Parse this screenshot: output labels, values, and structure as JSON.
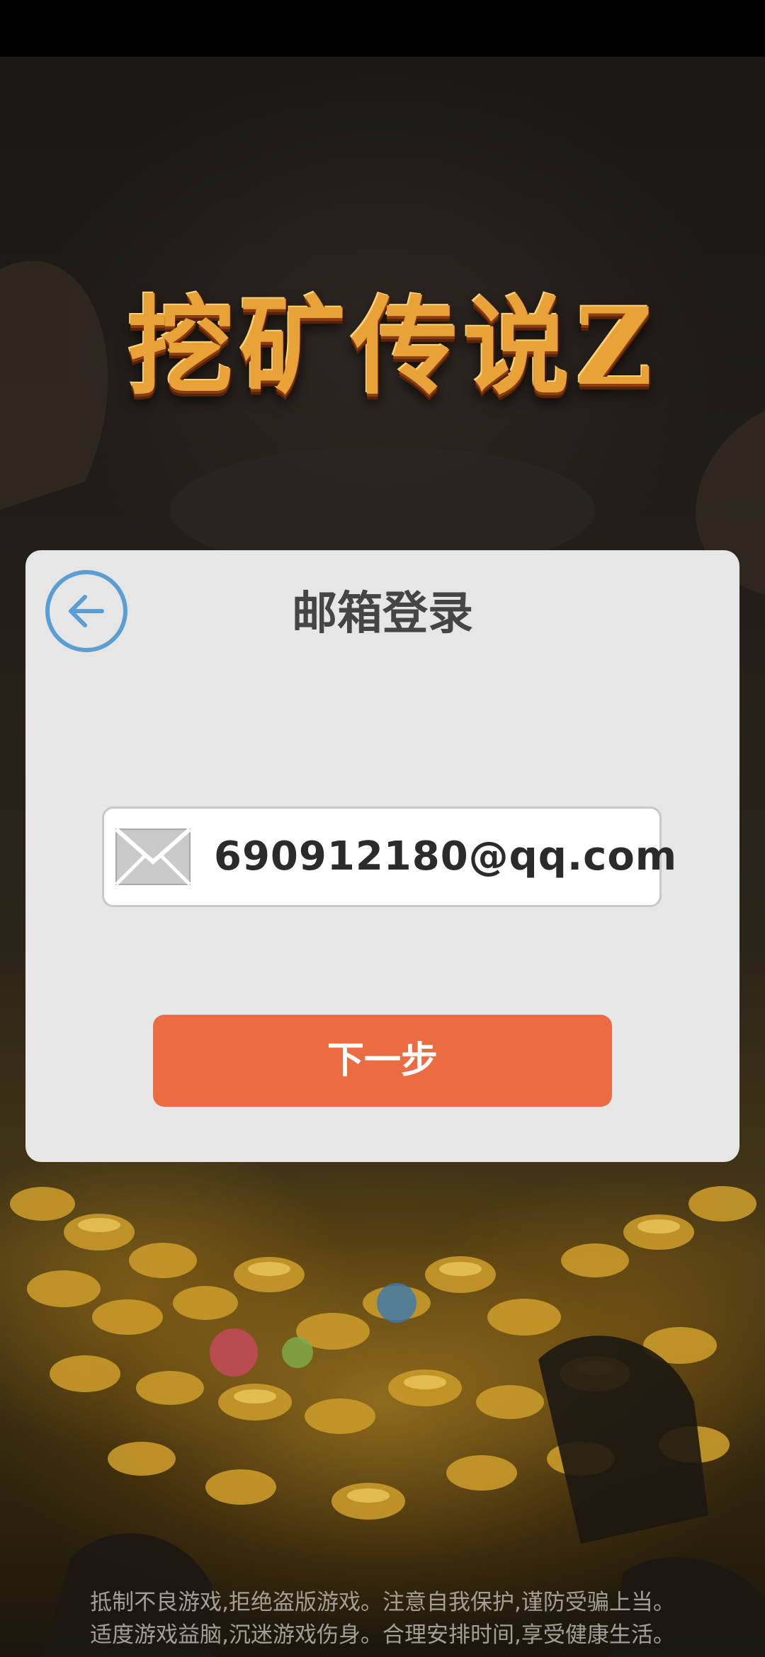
{
  "game": {
    "logo_text": "挖矿传说Z"
  },
  "dialog": {
    "title": "邮箱登录",
    "email": {
      "value": "690912180@qq.com",
      "icon": "envelope-icon"
    },
    "next_button_label": "下一步",
    "back_icon": "arrow-left-circle-icon"
  },
  "notice": {
    "line1": "抵制不良游戏,拒绝盗版游戏。注意自我保护,谨防受骗上当。",
    "line2": "适度游戏益脑,沉迷游戏伤身。合理安排时间,享受健康生活。"
  },
  "colors": {
    "dialog_bg": "#e6e6e6",
    "back_accent": "#5b9ed3",
    "button_primary": "#eb6c42",
    "title_text": "#454545"
  }
}
